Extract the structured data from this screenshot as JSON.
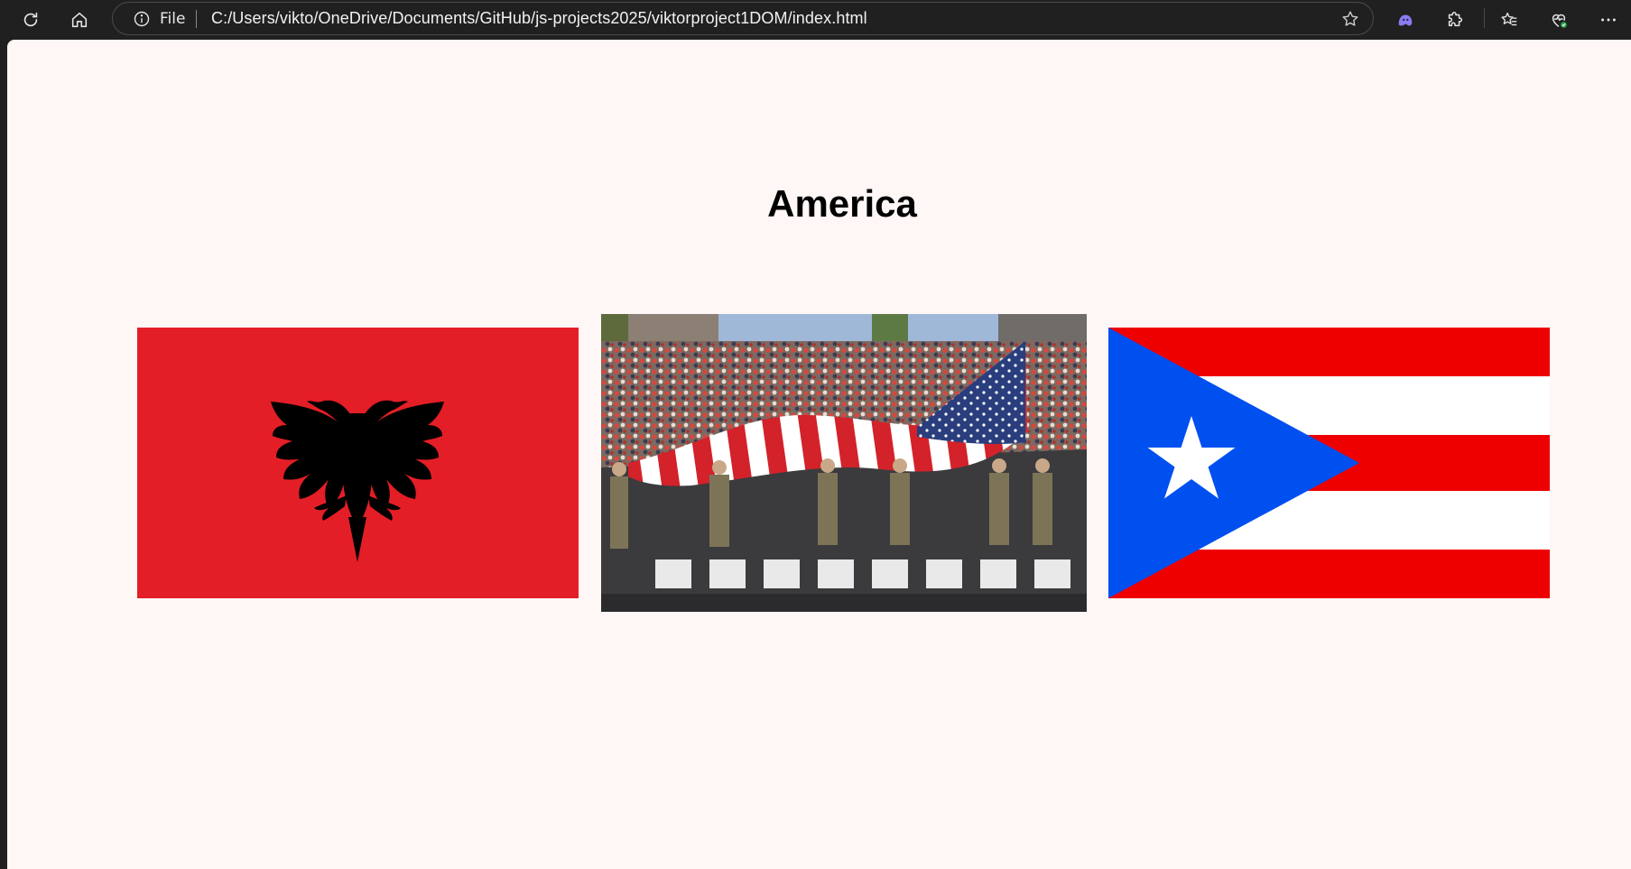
{
  "browser": {
    "address_scheme_label": "File",
    "url": "C:/Users/vikto/OneDrive/Documents/GitHub/js-projects2025/viktorproject1DOM/index.html",
    "icons": [
      "refresh-icon",
      "home-icon",
      "info-icon",
      "star-icon",
      "copilot-icon",
      "extensions-icon",
      "favorites-icon",
      "browser-essentials-icon",
      "more-icon"
    ]
  },
  "page": {
    "heading": "America",
    "background": "#fff6f6",
    "images": [
      {
        "name": "albania-flag",
        "colors": {
          "red": "#e41e26",
          "eagle": "#000000"
        }
      },
      {
        "name": "american-flag-parade-photo"
      },
      {
        "name": "puerto-rico-flag",
        "colors": {
          "red": "#ef0000",
          "blue": "#0050f0",
          "white": "#ffffff"
        }
      }
    ]
  }
}
